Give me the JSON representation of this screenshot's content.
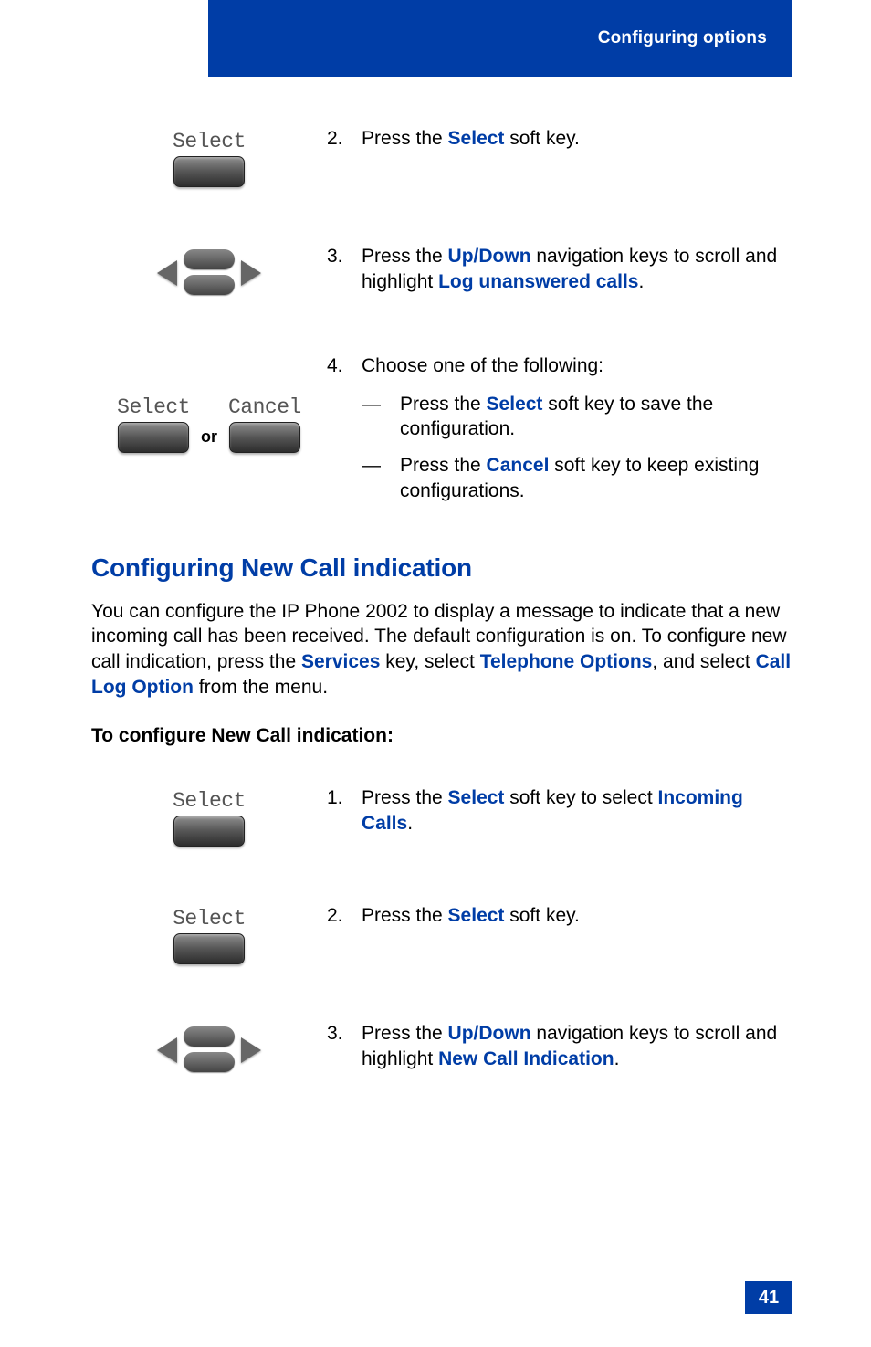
{
  "header": {
    "title": "Configuring options"
  },
  "softkeys": {
    "select": "Select",
    "cancel": "Cancel",
    "or": "or"
  },
  "step2": {
    "num": "2.",
    "t1": "Press the ",
    "k1": "Select",
    "t2": " soft key."
  },
  "step3": {
    "num": "3.",
    "t1": "Press the ",
    "k1": "Up/Down",
    "t2": " navigation keys to scroll and highlight ",
    "k2": "Log unanswered calls",
    "t3": "."
  },
  "step4": {
    "num": "4.",
    "lead": "Choose one of the following:",
    "a": {
      "dash": "—",
      "t1": "Press the ",
      "k1": "Select",
      "t2": " soft key to save the configuration."
    },
    "b": {
      "dash": "—",
      "t1": "Press the ",
      "k1": "Cancel",
      "t2": " soft key to keep existing configurations."
    }
  },
  "section": {
    "title": "Configuring New Call indication",
    "p": {
      "t1": "You can configure the IP Phone 2002 to display a message to indicate that a new incoming call has been received. The default configuration is on. To configure new call indication, press the ",
      "k1": "Services",
      "t2": " key, select ",
      "k2": "Telephone Options",
      "t3": ",  and select ",
      "k3": "Call Log Option",
      "t4": " from the menu."
    },
    "sub": "To configure New Call indication:"
  },
  "b1": {
    "num": "1.",
    "t1": "Press the ",
    "k1": "Select",
    "t2": " soft key to select ",
    "k2": "Incoming Calls",
    "t3": "."
  },
  "b2": {
    "num": "2.",
    "t1": "Press the ",
    "k1": "Select",
    "t2": " soft key."
  },
  "b3": {
    "num": "3.",
    "t1": "Press the ",
    "k1": "Up/Down",
    "t2": " navigation keys to scroll and highlight ",
    "k2": "New Call Indication",
    "t3": "."
  },
  "page": "41"
}
